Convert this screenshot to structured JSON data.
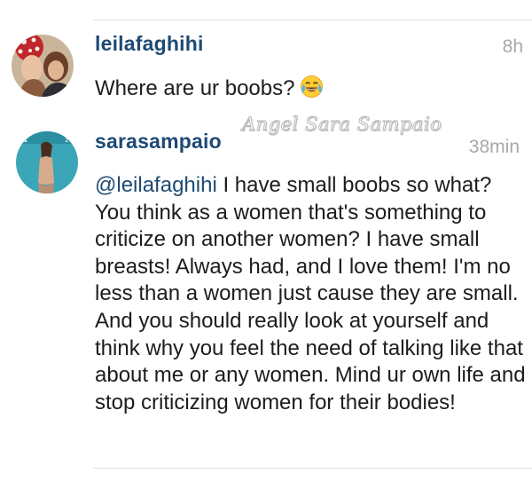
{
  "comments": [
    {
      "username": "leilafaghihi",
      "time": "8h",
      "text": "Where are ur boobs?",
      "emoji_icon": "face-with-tears-of-joy-icon"
    },
    {
      "username": "sarasampaio",
      "time": "38min",
      "mention": "@leilafaghihi",
      "text": "I have small boobs so what? You think as a women that's something to criticize on another women? I have small breasts! Always had, and I love them! I'm no less than a women just cause they are small. And you should really look at yourself and think why you feel the need of talking like that about me or any women. Mind ur own life and stop criticizing women for their bodies!"
    }
  ],
  "watermark": "Angel Sara Sampaio",
  "colors": {
    "username": "#1e4a74",
    "timestamp": "#a8a8a8",
    "divider": "#dedede"
  }
}
